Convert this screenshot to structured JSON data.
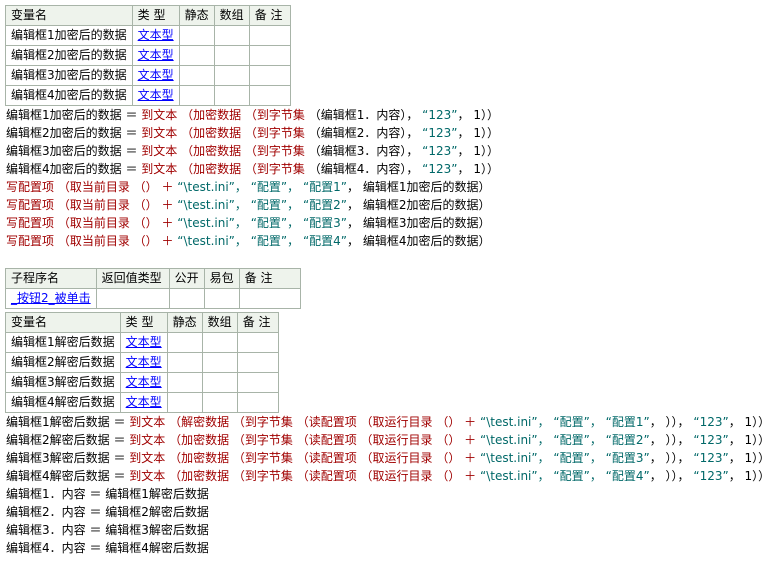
{
  "table1": {
    "headers": [
      "变量名",
      "类 型",
      "静态",
      "数组",
      "备 注"
    ],
    "rows": [
      [
        "编辑框1加密后的数据",
        "文本型",
        "",
        "",
        ""
      ],
      [
        "编辑框2加密后的数据",
        "文本型",
        "",
        "",
        ""
      ],
      [
        "编辑框3加密后的数据",
        "文本型",
        "",
        "",
        ""
      ],
      [
        "编辑框4加密后的数据",
        "文本型",
        "",
        "",
        ""
      ]
    ]
  },
  "code1": [
    [
      [
        "编辑框1加密后的数据 ＝ ",
        "blk"
      ],
      [
        "到文本 （加密数据 （到字节集 ",
        "cmd"
      ],
      [
        "（编辑框1．内容）， ",
        "blk"
      ],
      [
        "“123”",
        "str"
      ],
      [
        "， 1））",
        "blk"
      ]
    ],
    [
      [
        "编辑框2加密后的数据 ＝ ",
        "blk"
      ],
      [
        "到文本 （加密数据 （到字节集 ",
        "cmd"
      ],
      [
        "（编辑框2．内容）， ",
        "blk"
      ],
      [
        "“123”",
        "str"
      ],
      [
        "， 1））",
        "blk"
      ]
    ],
    [
      [
        "编辑框3加密后的数据 ＝ ",
        "blk"
      ],
      [
        "到文本 （加密数据 （到字节集 ",
        "cmd"
      ],
      [
        "（编辑框3．内容）， ",
        "blk"
      ],
      [
        "“123”",
        "str"
      ],
      [
        "， 1））",
        "blk"
      ]
    ],
    [
      [
        "编辑框4加密后的数据 ＝ ",
        "blk"
      ],
      [
        "到文本 （加密数据 （到字节集 ",
        "cmd"
      ],
      [
        "（编辑框4．内容）， ",
        "blk"
      ],
      [
        "“123”",
        "str"
      ],
      [
        "， 1））",
        "blk"
      ]
    ],
    [
      [
        "写配置项 （取当前目录 （） ＋ ",
        "cmd"
      ],
      [
        "“\\test.ini”， “配置”， “配置1”",
        "str"
      ],
      [
        "， 编辑框1加密后的数据）",
        "blk"
      ]
    ],
    [
      [
        "写配置项 （取当前目录 （） ＋ ",
        "cmd"
      ],
      [
        "“\\test.ini”， “配置”， “配置2”",
        "str"
      ],
      [
        "， 编辑框2加密后的数据）",
        "blk"
      ]
    ],
    [
      [
        "写配置项 （取当前目录 （） ＋ ",
        "cmd"
      ],
      [
        "“\\test.ini”， “配置”， “配置3”",
        "str"
      ],
      [
        "， 编辑框3加密后的数据）",
        "blk"
      ]
    ],
    [
      [
        "写配置项 （取当前目录 （） ＋ ",
        "cmd"
      ],
      [
        "“\\test.ini”， “配置”， “配置4”",
        "str"
      ],
      [
        "， 编辑框4加密后的数据）",
        "blk"
      ]
    ]
  ],
  "sub_table": {
    "headers": [
      "子程序名",
      "返回值类型",
      "公开",
      "易包",
      "备 注"
    ],
    "row": [
      "_按钮2_被单击",
      "",
      "",
      "",
      ""
    ]
  },
  "table2": {
    "headers": [
      "变量名",
      "类 型",
      "静态",
      "数组",
      "备 注"
    ],
    "rows": [
      [
        "编辑框1解密后数据",
        "文本型",
        "",
        "",
        ""
      ],
      [
        "编辑框2解密后数据",
        "文本型",
        "",
        "",
        ""
      ],
      [
        "编辑框3解密后数据",
        "文本型",
        "",
        "",
        ""
      ],
      [
        "编辑框4解密后数据",
        "文本型",
        "",
        "",
        ""
      ]
    ]
  },
  "code2": [
    [
      [
        "编辑框1解密后数据 ＝ ",
        "blk"
      ],
      [
        "到文本 （解密数据 （到字节集 （读配置项 （取运行目录 （） ＋ ",
        "cmd"
      ],
      [
        "“\\test.ini”， “配置”， “配置1”",
        "str"
      ],
      [
        "， ））， ",
        "blk"
      ],
      [
        "“123”",
        "str"
      ],
      [
        "， 1））",
        "blk"
      ]
    ],
    [
      [
        "编辑框2解密后数据 ＝ ",
        "blk"
      ],
      [
        "到文本 （加密数据 （到字节集 （读配置项 （取运行目录 （） ＋ ",
        "cmd"
      ],
      [
        "“\\test.ini”， “配置”， “配置2”",
        "str"
      ],
      [
        "， ））， ",
        "blk"
      ],
      [
        "“123”",
        "str"
      ],
      [
        "， 1））",
        "blk"
      ]
    ],
    [
      [
        "编辑框3解密后数据 ＝ ",
        "blk"
      ],
      [
        "到文本 （加密数据 （到字节集 （读配置项 （取运行目录 （） ＋ ",
        "cmd"
      ],
      [
        "“\\test.ini”， “配置”， “配置3”",
        "str"
      ],
      [
        "， ））， ",
        "blk"
      ],
      [
        "“123”",
        "str"
      ],
      [
        "， 1））",
        "blk"
      ]
    ],
    [
      [
        "编辑框4解密后数据 ＝ ",
        "blk"
      ],
      [
        "到文本 （加密数据 （到字节集 （读配置项 （取运行目录 （） ＋ ",
        "cmd"
      ],
      [
        "“\\test.ini”， “配置”， “配置4”",
        "str"
      ],
      [
        "， ））， ",
        "blk"
      ],
      [
        "“123”",
        "str"
      ],
      [
        "， 1））",
        "blk"
      ]
    ],
    [
      [
        "编辑框1．内容 ＝ 编辑框1解密后数据",
        "blk"
      ]
    ],
    [
      [
        "编辑框2．内容 ＝ 编辑框2解密后数据",
        "blk"
      ]
    ],
    [
      [
        "编辑框3．内容 ＝ 编辑框3解密后数据",
        "blk"
      ]
    ],
    [
      [
        "编辑框4．内容 ＝ 编辑框4解密后数据",
        "blk"
      ]
    ]
  ]
}
